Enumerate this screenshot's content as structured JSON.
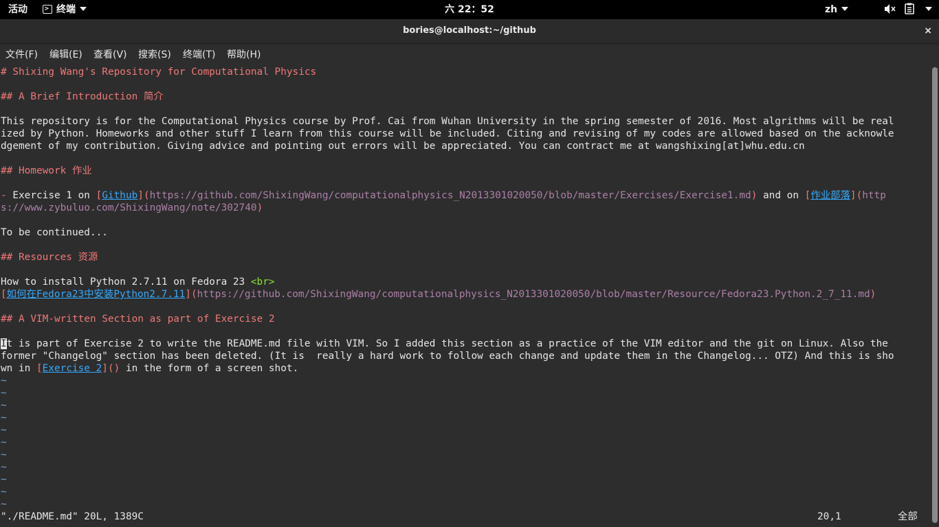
{
  "topbar": {
    "activities": "活动",
    "app_menu": "终端",
    "clock": "六 22：52",
    "input_method": "zh"
  },
  "window": {
    "title": "bories@localhost:~/github",
    "close": "×"
  },
  "menu": {
    "file": "文件(F)",
    "edit": "编辑(E)",
    "view": "查看(V)",
    "search": "搜索(S)",
    "terminal": "终端(T)",
    "help": "帮助(H)"
  },
  "content": {
    "title": "# Shixing Wang's Repository for Computational Physics",
    "intro_heading": "## A Brief Introduction 简介",
    "intro_line1": "This repository is for the Computational Physics course by Prof. Cai from Wuhan University in the spring semester of 2016. Most algrithms will be real",
    "intro_line2": "ized by Python. Homeworks and other stuff I learn from this course will be included. Citing and revising of my codes are allowed based on the acknowle",
    "intro_line3": "dgement of my contribution. Giving advice and pointing out errors will be appreciated. You can contract me at wangshixing[at]whu.edu.cn",
    "homework_heading": "## Homework 作业",
    "hw_dash": "-",
    "hw_text1": " Exercise 1 on ",
    "hw_github_text": "Github",
    "hw_github_url": "https://github.com/ShixingWang/computationalphysics_N2013301020050/blob/master/Exercises/Exercise1.md",
    "hw_text2": " and on ",
    "hw_zybuluo_text": "作业部落",
    "hw_zybuluo_url_part1": "http",
    "hw_zybuluo_url_part2": "s://www.zybuluo.com/ShixingWang/note/302740",
    "to_be_continued": "To be continued...",
    "resources_heading": "## Resources 资源",
    "install_text": "How to install Python 2.7.11 on Fedora 23 ",
    "install_tag": "<br>",
    "install_link_text": "如何在Fedora23中安装Python2.7.11",
    "install_url": "https://github.com/ShixingWang/computationalphysics_N2013301020050/blob/master/Resource/Fedora23.Python.2_7_11.md",
    "vim_heading": "## A VIM-written Section as part of Exercise 2",
    "vim_cursor_char": "I",
    "vim_line1_rest": "t is part of Exercise 2 to write the README.md file with VIM. So I added this section as a practice of the VIM editor and the git on Linux. Also the",
    "vim_line2": "former \"Changelog\" section has been deleted. (It is  really a hard work to follow each change and update them in the Changelog... OTZ) And this is sho",
    "vim_line3_a": "wn in ",
    "vim_exercise2_text": "Exercise 2",
    "vim_line3_b": " in the form of a screen shot.",
    "tilde": "~"
  },
  "status": {
    "file": "\"./README.md\" 20L, 1389C",
    "position": "20,1",
    "scroll": "全部"
  }
}
